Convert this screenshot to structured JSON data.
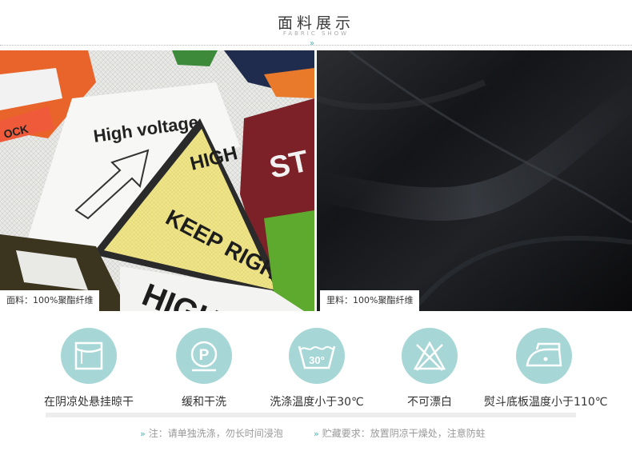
{
  "header": {
    "title": "面料展示",
    "subtitle": "FABRIC SHOW",
    "accent_color": "#4fb3b1"
  },
  "fabrics": {
    "outer": {
      "label": "面料：100%聚酯纤维",
      "print_text": [
        "High voltage",
        "KEEP RIGHT",
        "ST",
        "HIGH",
        "OCK",
        "HIGH"
      ]
    },
    "lining": {
      "label": "里料：100%聚酯纤维"
    }
  },
  "care": [
    {
      "icon": "hang-dry-in-shade-icon",
      "label": "在阴凉处悬挂晾干"
    },
    {
      "icon": "gentle-dry-clean-icon",
      "label": "缓和干洗",
      "glyph": "P"
    },
    {
      "icon": "wash-30-icon",
      "label": "洗涤温度小于30℃",
      "glyph": "30°"
    },
    {
      "icon": "no-bleach-icon",
      "label": "不可漂白"
    },
    {
      "icon": "iron-110-icon",
      "label": "熨斗底板温度小于110℃"
    }
  ],
  "care_color": "#a6d7d6",
  "notes": [
    {
      "label": "注：请单独洗涤，勿长时间浸泡"
    },
    {
      "label": "贮藏要求：放置阴凉干燥处，注意防蛀"
    }
  ]
}
